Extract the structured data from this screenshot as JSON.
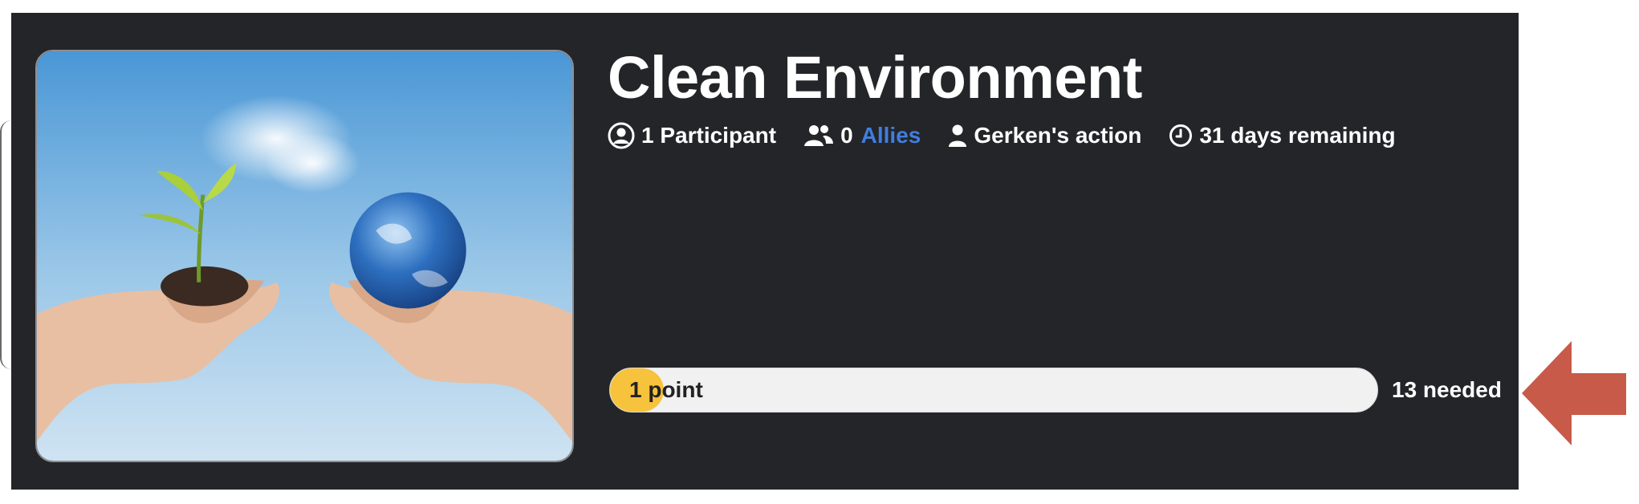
{
  "action": {
    "title": "Clean Environment",
    "image_alt": "Hands holding a sprouting plant and the Earth against a blue sky",
    "meta": {
      "participants": {
        "icon": "user-circle-icon",
        "text": "1 Participant"
      },
      "allies": {
        "icon": "users-icon",
        "count": "0",
        "link_label": "Allies"
      },
      "owner": {
        "icon": "user-icon",
        "text": "Gerken's action"
      },
      "time": {
        "icon": "clock-icon",
        "text": "31 days remaining"
      }
    },
    "progress": {
      "label": "1 point",
      "needed": "13 needed",
      "fraction": 0.07
    }
  },
  "annotation": {
    "icon": "left-arrow-icon",
    "color": "#c75a48"
  },
  "colors": {
    "card_bg": "#242528",
    "link": "#3f7ee0",
    "progress_fill": "#f7c23c",
    "progress_track": "#f1f1f1"
  }
}
